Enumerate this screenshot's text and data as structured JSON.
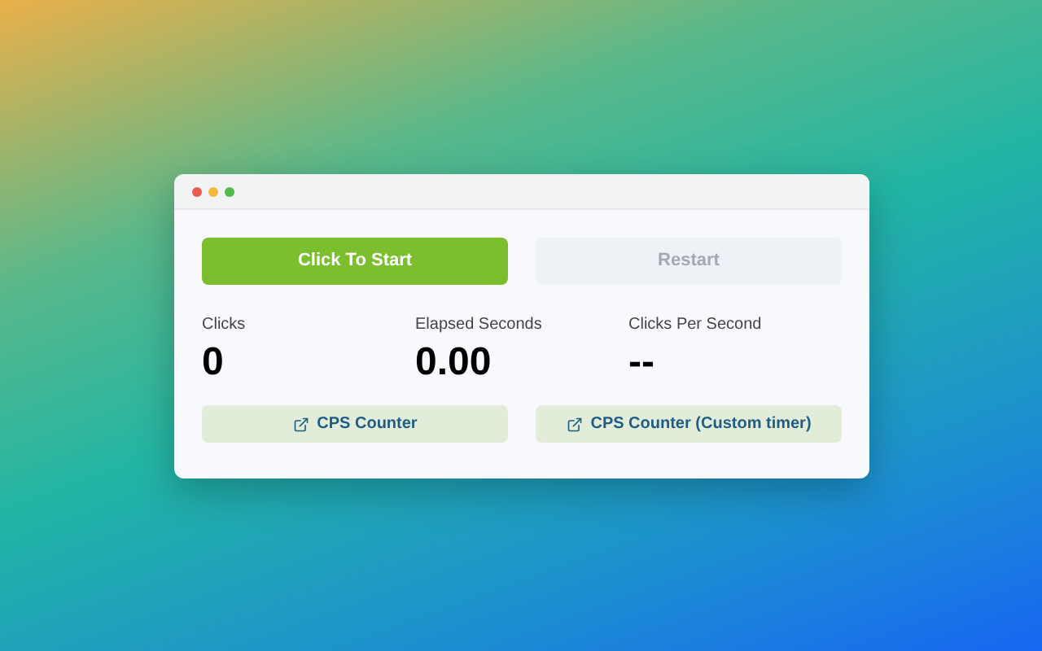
{
  "window": {
    "controls": [
      {
        "color": "#ee5b55"
      },
      {
        "color": "#f5b83d"
      },
      {
        "color": "#4cbc4c"
      }
    ]
  },
  "buttons": [
    {
      "label": "Click To Start",
      "disabled": false
    },
    {
      "label": "Restart",
      "disabled": true
    }
  ],
  "stats": [
    {
      "label": "Clicks",
      "value": "0"
    },
    {
      "label": "Elapsed Seconds",
      "value": "0.00"
    },
    {
      "label": "Clicks Per Second",
      "value": "--"
    }
  ],
  "links": [
    {
      "label": "CPS Counter"
    },
    {
      "label": "CPS Counter (Custom timer)"
    }
  ]
}
